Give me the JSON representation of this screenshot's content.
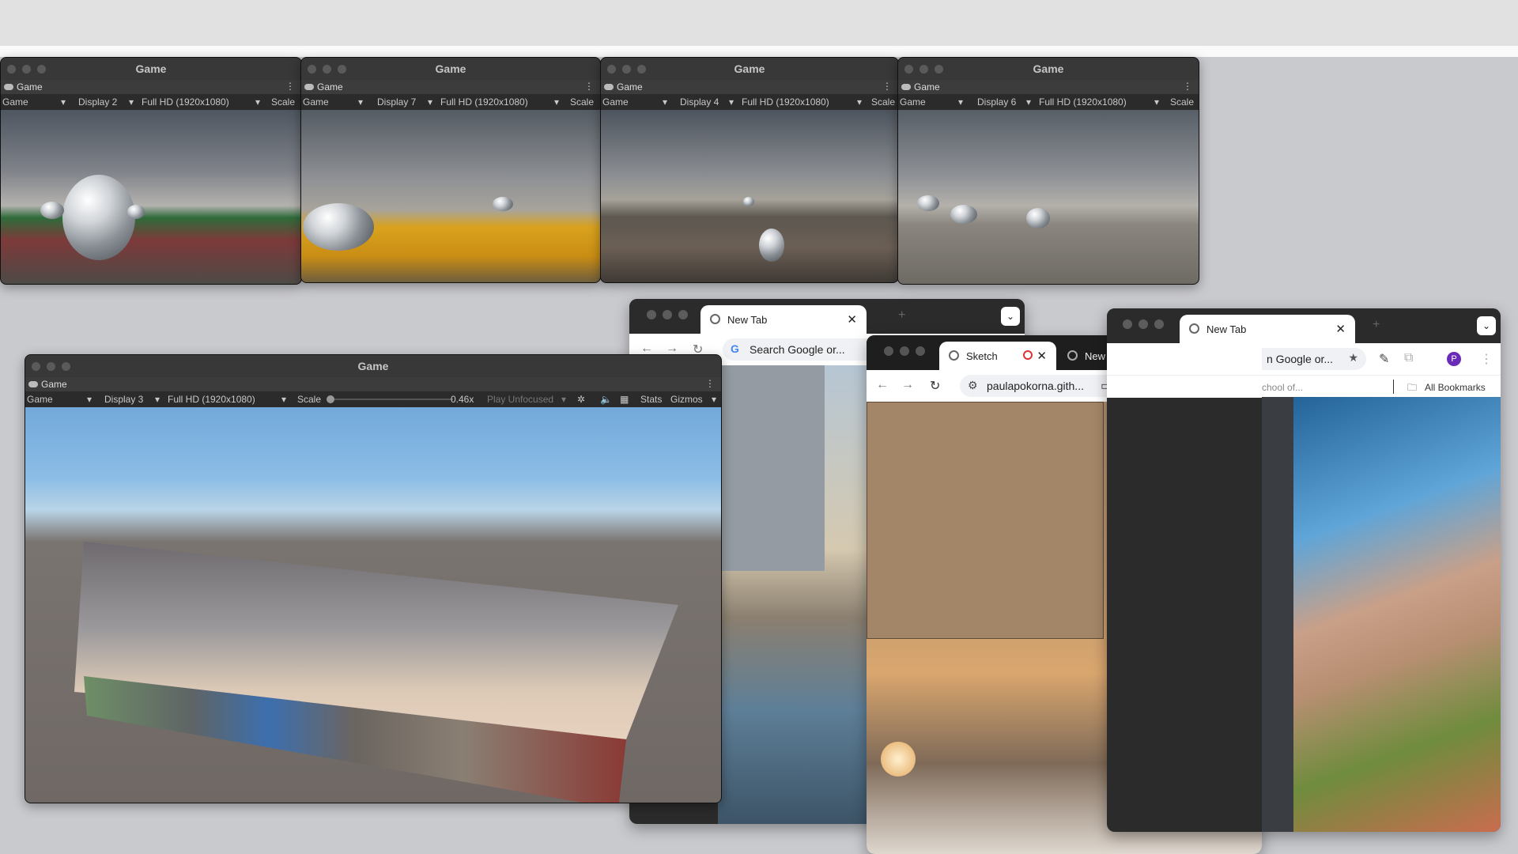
{
  "unity_windows": [
    {
      "title": "Game",
      "tab": "Game",
      "mode": "Game",
      "display": "Display 2",
      "resolution": "Full HD (1920x1080)",
      "scale_label": "Scale"
    },
    {
      "title": "Game",
      "tab": "Game",
      "mode": "Game",
      "display": "Display 7",
      "resolution": "Full HD (1920x1080)",
      "scale_label": "Scale"
    },
    {
      "title": "Game",
      "tab": "Game",
      "mode": "Game",
      "display": "Display 4",
      "resolution": "Full HD (1920x1080)",
      "scale_label": "Scale"
    },
    {
      "title": "Game",
      "tab": "Game",
      "mode": "Game",
      "display": "Display 6",
      "resolution": "Full HD (1920x1080)",
      "scale_label": "Scale"
    }
  ],
  "main_unity": {
    "title": "Game",
    "tab": "Game",
    "mode": "Game",
    "display": "Display 3",
    "resolution": "Full HD (1920x1080)",
    "scale_label": "Scale",
    "scale_value": "0.46x",
    "play_mode": "Play Unfocused",
    "stats": "Stats",
    "gizmos": "Gizmos"
  },
  "chrome_back": {
    "tab_title": "New Tab",
    "search_placeholder": "Search Google or..."
  },
  "chrome_sketch": {
    "tabs": [
      {
        "title": "Sketch"
      },
      {
        "title": "New Tab"
      }
    ],
    "new_tab": "+",
    "url": "paulapokorna.gith..."
  },
  "chrome_right": {
    "tab_title": "New Tab",
    "search_partial": "n Google or...",
    "bookmark_partial": "chool of...",
    "all_bookmarks": "All Bookmarks",
    "avatar_letter": "P"
  },
  "colors": {
    "unity_dark": "#383838",
    "chrome_dark": "#2b2b2b",
    "accent": "#6a2bb8"
  }
}
